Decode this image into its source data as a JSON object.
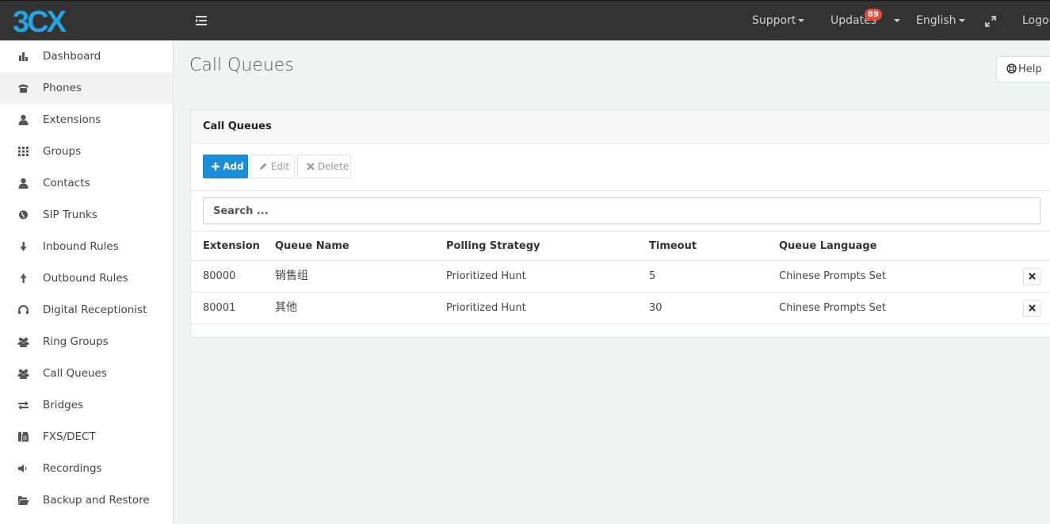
{
  "topbar": {
    "logo_text": "3CX",
    "support": "Support",
    "updates": "Updates",
    "updates_count": "89",
    "language": "English",
    "logout": "Logout"
  },
  "sidebar": {
    "items": [
      {
        "label": "Dashboard",
        "icon": "bar-chart-icon"
      },
      {
        "label": "Phones",
        "icon": "phone-icon"
      },
      {
        "label": "Extensions",
        "icon": "user-icon"
      },
      {
        "label": "Groups",
        "icon": "grid-icon"
      },
      {
        "label": "Contacts",
        "icon": "user-icon"
      },
      {
        "label": "SIP Trunks",
        "icon": "globe-icon"
      },
      {
        "label": "Inbound Rules",
        "icon": "arrow-down-icon"
      },
      {
        "label": "Outbound Rules",
        "icon": "arrow-up-icon"
      },
      {
        "label": "Digital Receptionist",
        "icon": "headset-icon"
      },
      {
        "label": "Ring Groups",
        "icon": "users-icon"
      },
      {
        "label": "Call Queues",
        "icon": "users-icon"
      },
      {
        "label": "Bridges",
        "icon": "exchange-icon"
      },
      {
        "label": "FXS/DECT",
        "icon": "fax-icon"
      },
      {
        "label": "Recordings",
        "icon": "volume-icon"
      },
      {
        "label": "Backup and Restore",
        "icon": "folder-open-icon"
      }
    ]
  },
  "main": {
    "page_title": "Call Queues",
    "help_label": "Help",
    "panel_title": "Call Queues",
    "buttons": {
      "add": "Add",
      "edit": "Edit",
      "delete": "Delete"
    },
    "search_placeholder": "Search ...",
    "table": {
      "headers": [
        "Extension",
        "Queue Name",
        "Polling Strategy",
        "Timeout",
        "Queue Language"
      ],
      "rows": [
        {
          "extension": "80000",
          "name": "销售组",
          "strategy": "Prioritized Hunt",
          "timeout": "5",
          "language": "Chinese Prompts Set"
        },
        {
          "extension": "80001",
          "name": "其他",
          "strategy": "Prioritized Hunt",
          "timeout": "30",
          "language": "Chinese Prompts Set"
        }
      ]
    }
  },
  "colors": {
    "topbar": "#333333",
    "accent_blue": "#1a8ed9",
    "badge_red": "#e84c3d",
    "logo_blue": "#27a4e0"
  }
}
